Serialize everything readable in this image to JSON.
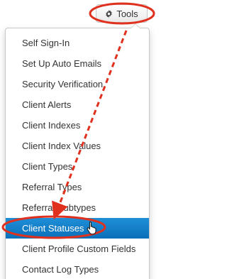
{
  "tools_button": {
    "label": "Tools",
    "icon": "gear-icon"
  },
  "menu": {
    "items": [
      {
        "label": "Self Sign-In"
      },
      {
        "label": "Set Up Auto Emails"
      },
      {
        "label": "Security Verification"
      },
      {
        "label": "Client Alerts"
      },
      {
        "label": "Client Indexes"
      },
      {
        "label": "Client Index Values"
      },
      {
        "label": "Client Types"
      },
      {
        "label": "Referral Types"
      },
      {
        "label": "Referral Subtypes"
      },
      {
        "label": "Client Statuses",
        "active": true
      },
      {
        "label": "Client Profile Custom Fields"
      },
      {
        "label": "Contact Log Types"
      }
    ],
    "active_color": "#0a6fb8"
  },
  "annotation": {
    "highlight_color": "#e0301e",
    "cursor": "hand-pointer-icon"
  }
}
